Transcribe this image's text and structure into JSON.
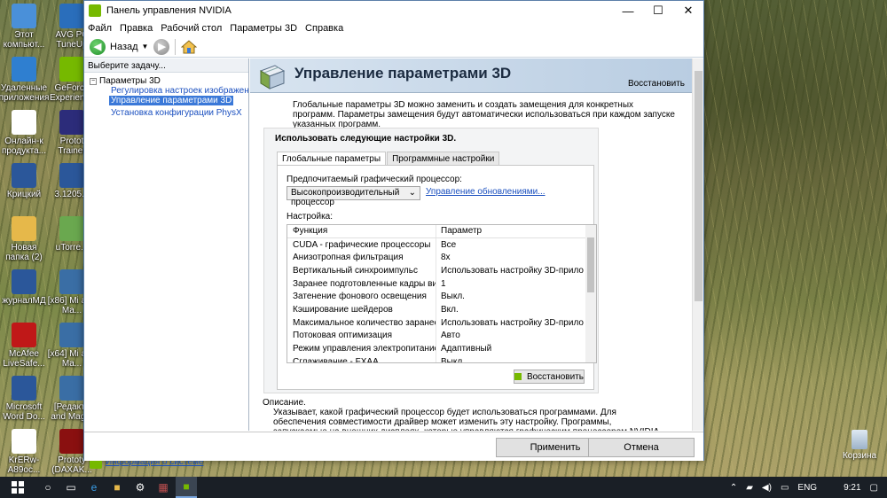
{
  "desktop": {
    "icons": [
      {
        "label": "Этот компьют...",
        "icon": "computer-icon",
        "color": "#4a90d9"
      },
      {
        "label": "AVG PC TuneUp",
        "icon": "avg-icon",
        "color": "#2a6ebb"
      },
      {
        "label": "Удаленные приложения",
        "icon": "remote-apps-icon",
        "color": "#2f7fd0"
      },
      {
        "label": "GeForce Experience",
        "icon": "geforce-icon",
        "color": "#76b900"
      },
      {
        "label": "Онлайн-к продукта...",
        "icon": "document-icon",
        "color": "#ffffff"
      },
      {
        "label": "Protot Trainer",
        "icon": "trainer-icon",
        "color": "#2c2c7a"
      },
      {
        "label": "Крицкий",
        "icon": "word-doc-icon",
        "color": "#2b579a"
      },
      {
        "label": "3.1205...",
        "icon": "word-doc-icon",
        "color": "#2b579a"
      },
      {
        "label": "Новая папка (2)",
        "icon": "folder-icon",
        "color": "#e6b84a"
      },
      {
        "label": "uTorre...",
        "icon": "utorrent-icon",
        "color": "#6aa84f"
      },
      {
        "label": "журналМД",
        "icon": "word-doc-icon",
        "color": "#2b579a"
      },
      {
        "label": "[x86] Mi and Ma...",
        "icon": "game-icon",
        "color": "#3a6ea5"
      },
      {
        "label": "McAfee LiveSafe...",
        "icon": "mcafee-icon",
        "color": "#c01818"
      },
      {
        "label": "[x64] Mi and Ma...",
        "icon": "game-icon",
        "color": "#3a6ea5"
      },
      {
        "label": "Microsoft Word Do...",
        "icon": "word-doc-icon",
        "color": "#2b579a"
      },
      {
        "label": "[Редакто and Mag...",
        "icon": "game-icon",
        "color": "#3a6ea5"
      },
      {
        "label": "KrERw-A89oc...",
        "icon": "document-icon",
        "color": "#ffffff"
      },
      {
        "label": "Prototy (DAXAK...",
        "icon": "trainer-icon",
        "color": "#8a1010"
      }
    ],
    "recycle_bin": "Корзина"
  },
  "window": {
    "title": "Панель управления NVIDIA",
    "controls": {
      "minimize": "—",
      "maximize": "☐",
      "close": "✕"
    },
    "menu": [
      "Файл",
      "Правка",
      "Рабочий стол",
      "Параметры 3D",
      "Справка"
    ],
    "toolbar": {
      "back_label": "Назад"
    }
  },
  "left_panel": {
    "header": "Выберите задачу...",
    "root": "Параметры 3D",
    "items": [
      {
        "label": "Регулировка настроек изображения с пр",
        "selected": false
      },
      {
        "label": "Управление параметрами 3D",
        "selected": true
      },
      {
        "label": "Установка конфигурации PhysX",
        "selected": false
      }
    ],
    "sysinfo_link": "Информация о системе"
  },
  "main": {
    "title": "Управление параметрами 3D",
    "restore_link": "Восстановить",
    "description": "Глобальные параметры 3D можно заменить и создать замещения для конкретных программ. Параметры замещения будут автоматически использоваться при каждом запуске указанных программ.",
    "group_title": "Использовать следующие настройки 3D.",
    "tabs": [
      {
        "label": "Глобальные параметры",
        "active": true
      },
      {
        "label": "Программные настройки",
        "active": false
      }
    ],
    "preferred_gpu_label": "Предпочитаемый графический процессор:",
    "preferred_gpu_value": "Высокопроизводительный процессор",
    "updates_link": "Управление обновлениями...",
    "settings_label": "Настройка:",
    "table": {
      "headers": [
        "Функция",
        "Параметр"
      ],
      "rows": [
        [
          "CUDA - графические процессоры",
          "Все"
        ],
        [
          "Анизотропная фильтрация",
          "8x"
        ],
        [
          "Вертикальный синхроимпульс",
          "Использовать настройку 3D-приложения"
        ],
        [
          "Заранее подготовленные кадры вирту...",
          "1"
        ],
        [
          "Затенение фонового освещения",
          "Выкл."
        ],
        [
          "Кэширование шейдеров",
          "Вкл."
        ],
        [
          "Максимальное количество заранее под...",
          "Использовать настройку 3D-приложения"
        ],
        [
          "Потоковая оптимизация",
          "Авто"
        ],
        [
          "Режим управления электропитанием",
          "Адаптивный"
        ],
        [
          "Сглаживание - FXAA",
          "Выкл."
        ]
      ]
    },
    "table_restore_button": "Восстановить",
    "description_title": "Описание.",
    "description_text": "Указывает, какой графический процессор будет использоваться программами. Для обеспечения совместимости драйвер может изменить эту настройку. Программы, запускаемые на внешних дисплеях, которые управляются графическим процессором NVIDIA, всегда используют процессор NVIDIA."
  },
  "footer": {
    "apply": "Применить",
    "cancel": "Отмена"
  },
  "taskbar": {
    "language": "ENG",
    "time": "9:21"
  },
  "colors": {
    "nvidia_green": "#76b900",
    "link_blue": "#1a4fbf",
    "selection_blue": "#3a78d8"
  }
}
